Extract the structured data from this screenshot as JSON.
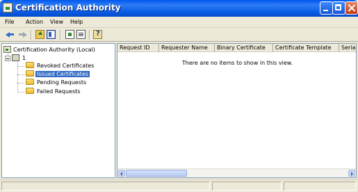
{
  "window": {
    "title": "Certification Authority"
  },
  "menu": {
    "items": [
      {
        "label": "File"
      },
      {
        "label": "Action"
      },
      {
        "label": "View"
      },
      {
        "label": "Help"
      }
    ]
  },
  "toolbar": {
    "icons": [
      "back-arrow-icon",
      "forward-arrow-icon",
      "up-folder-icon",
      "show-hide-tree-icon",
      "export-list-icon",
      "properties-icon",
      "help-icon"
    ]
  },
  "tree": {
    "root_label": "Certification Authority (Local)",
    "server_label": "1",
    "folders": [
      {
        "label": "Revoked Certificates",
        "selected": false
      },
      {
        "label": "Issued Certificates",
        "selected": true
      },
      {
        "label": "Pending Requests",
        "selected": false
      },
      {
        "label": "Failed Requests",
        "selected": false
      }
    ]
  },
  "list": {
    "columns": [
      {
        "label": "Request ID"
      },
      {
        "label": "Requester Name"
      },
      {
        "label": "Binary Certificate"
      },
      {
        "label": "Certificate Template"
      },
      {
        "label": "Serial"
      }
    ],
    "empty_message": "There are no items to show in this view."
  },
  "colors": {
    "titlebar": "#0A5DE8",
    "selection": "#316AC5",
    "window_face": "#ECE9D8"
  }
}
